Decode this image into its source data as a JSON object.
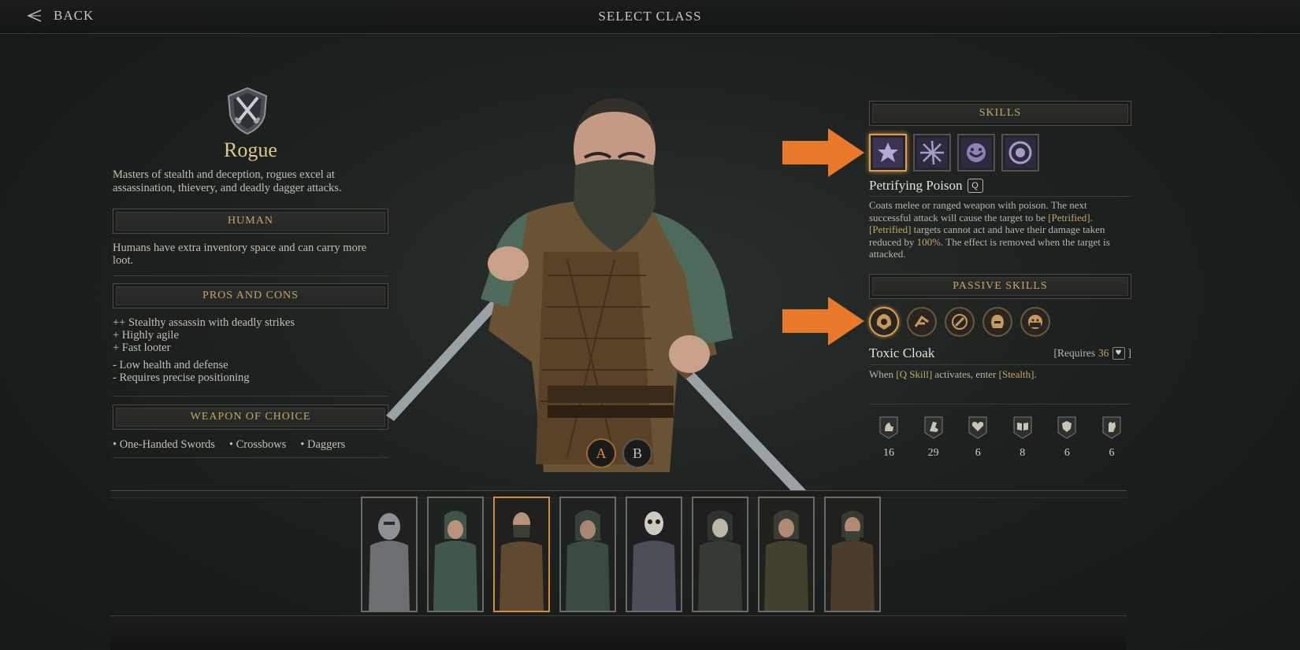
{
  "topbar": {
    "back_label": "BACK",
    "title": "SELECT CLASS"
  },
  "class": {
    "name": "Rogue",
    "description": "Masters of stealth and deception, rogues excel at assassination, thievery, and deadly dagger attacks."
  },
  "race": {
    "header": "HUMAN",
    "description": "Humans have extra inventory space and can carry more loot."
  },
  "pros_cons": {
    "header": "PROS AND CONS",
    "pros": [
      "++ Stealthy assassin with deadly strikes",
      "+ Highly agile",
      "+ Fast looter"
    ],
    "cons": [
      "- Low health and defense",
      "- Requires precise positioning"
    ]
  },
  "weapons": {
    "header": "WEAPON OF CHOICE",
    "items": [
      "• One-Handed Swords",
      "• Crossbows",
      "• Daggers"
    ]
  },
  "loadout": {
    "a_label": "A",
    "b_label": "B",
    "selected": "A"
  },
  "skills": {
    "header": "SKILLS",
    "icons": [
      "petrifying-poison-icon",
      "blade-flurry-icon",
      "shadow-mask-icon",
      "smoke-rose-icon"
    ],
    "selected_index": 0,
    "selected_name": "Petrifying Poison",
    "key": "Q",
    "desc": {
      "p1": "Coats melee or ranged weapon with poison. The next successful attack will cause the target to be ",
      "t1": "[Petrified]",
      "p2": ". ",
      "t2": "[Petrified]",
      "p3": " targets cannot act and have their damage taken reduced by ",
      "t3": "100%",
      "p4": ". The effect is removed when the target is attacked."
    }
  },
  "passives": {
    "header": "PASSIVE SKILLS",
    "icons": [
      "hooded-face-icon",
      "dash-icon",
      "dagger-circle-icon",
      "helmet-icon",
      "masked-face-icon"
    ],
    "selected_index": 0,
    "selected_name": "Toxic Cloak",
    "req_prefix": "[Requires",
    "req_value": "36",
    "req_suffix": "]",
    "req_icon": "heart-icon",
    "desc": {
      "p1": "When ",
      "t1": "[Q Skill]",
      "p2": " activates, enter ",
      "t2": "[Stealth]",
      "p3": "."
    }
  },
  "stats": [
    {
      "icon": "strength-icon",
      "value": "16"
    },
    {
      "icon": "agility-icon",
      "value": "29"
    },
    {
      "icon": "vitality-icon",
      "value": "6"
    },
    {
      "icon": "knowledge-icon",
      "value": "8"
    },
    {
      "icon": "will-icon",
      "value": "6"
    },
    {
      "icon": "faith-icon",
      "value": "6"
    }
  ],
  "roster": {
    "selected_index": 2,
    "portraits": [
      "knight",
      "ranger",
      "rogue",
      "hooded",
      "skeleton",
      "skull-mask",
      "mercenary",
      "bandit"
    ]
  },
  "colors": {
    "accent_gold": "#e0c58c",
    "header_gold": "#c5a56b",
    "selection_orange": "#d08d3f",
    "callout_arrow": "#e8782a"
  }
}
